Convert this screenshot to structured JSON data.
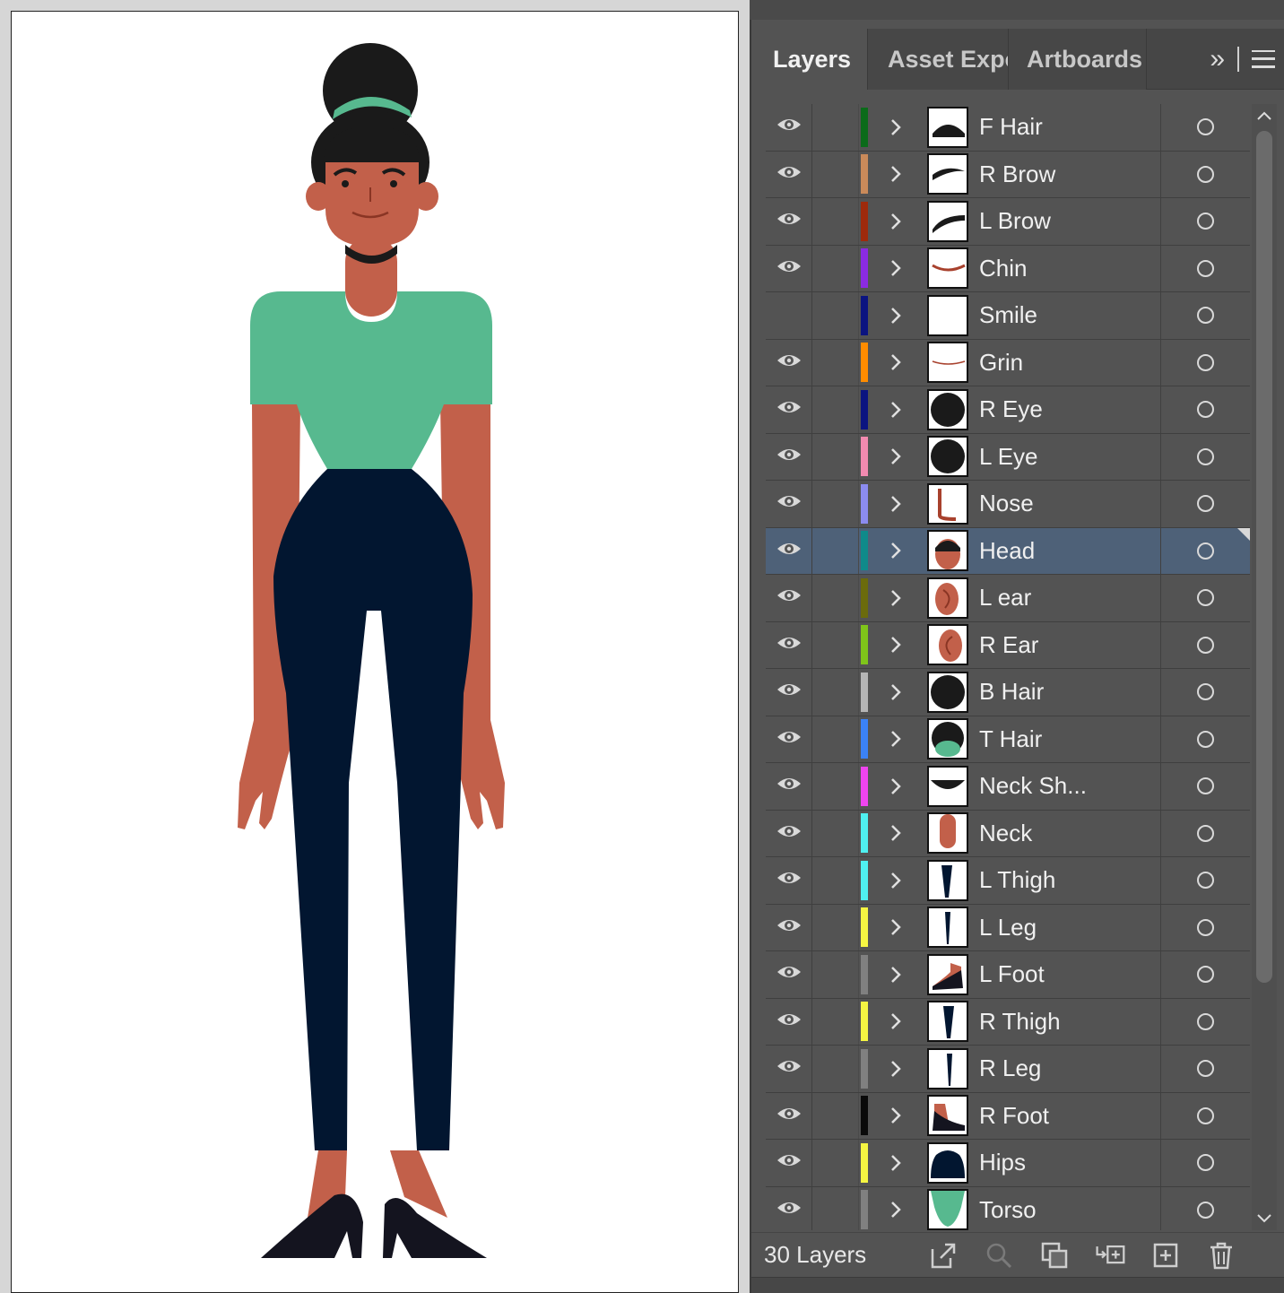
{
  "tabs": {
    "layers": "Layers",
    "asset_export": "Asset Expo",
    "artboards": "Artboards",
    "more": "»"
  },
  "layers": [
    {
      "name": "F Hair",
      "visible": true,
      "color": "#0b6b1a",
      "icon": "f-hair-thumb"
    },
    {
      "name": "R Brow",
      "visible": true,
      "color": "#c98a5a",
      "icon": "r-brow-thumb"
    },
    {
      "name": "L Brow",
      "visible": true,
      "color": "#9e2a0c",
      "icon": "l-brow-thumb"
    },
    {
      "name": "Chin",
      "visible": true,
      "color": "#8a2be2",
      "icon": "chin-thumb"
    },
    {
      "name": "Smile",
      "visible": false,
      "color": "#0b1480",
      "icon": "smile-thumb"
    },
    {
      "name": "Grin",
      "visible": true,
      "color": "#ff8c00",
      "icon": "grin-thumb"
    },
    {
      "name": "R Eye",
      "visible": true,
      "color": "#0b1480",
      "icon": "r-eye-thumb"
    },
    {
      "name": "L Eye",
      "visible": true,
      "color": "#f28ab0",
      "icon": "l-eye-thumb"
    },
    {
      "name": "Nose",
      "visible": true,
      "color": "#8c8cf0",
      "icon": "nose-thumb"
    },
    {
      "name": "Head",
      "visible": true,
      "color": "#0f8a8a",
      "icon": "head-thumb",
      "selected": true
    },
    {
      "name": "L ear",
      "visible": true,
      "color": "#6b6b0c",
      "icon": "l-ear-thumb"
    },
    {
      "name": "R Ear",
      "visible": true,
      "color": "#7fc41a",
      "icon": "r-ear-thumb"
    },
    {
      "name": "B Hair",
      "visible": true,
      "color": "#b5b5b5",
      "icon": "b-hair-thumb"
    },
    {
      "name": "T Hair",
      "visible": true,
      "color": "#3b82f6",
      "icon": "t-hair-thumb"
    },
    {
      "name": "Neck Sh...",
      "visible": true,
      "color": "#ee44ee",
      "icon": "neck-shadow-thumb"
    },
    {
      "name": "Neck",
      "visible": true,
      "color": "#4ff0f0",
      "icon": "neck-thumb"
    },
    {
      "name": "L Thigh",
      "visible": true,
      "color": "#4ff0f0",
      "icon": "l-thigh-thumb"
    },
    {
      "name": "L Leg",
      "visible": true,
      "color": "#f5f542",
      "icon": "l-leg-thumb"
    },
    {
      "name": "L Foot",
      "visible": true,
      "color": "#808080",
      "icon": "l-foot-thumb"
    },
    {
      "name": "R Thigh",
      "visible": true,
      "color": "#f5f542",
      "icon": "r-thigh-thumb"
    },
    {
      "name": "R Leg",
      "visible": true,
      "color": "#808080",
      "icon": "r-leg-thumb"
    },
    {
      "name": "R Foot",
      "visible": true,
      "color": "#0a0a0a",
      "icon": "r-foot-thumb"
    },
    {
      "name": "Hips",
      "visible": true,
      "color": "#f5f542",
      "icon": "hips-thumb"
    },
    {
      "name": "Torso",
      "visible": true,
      "color": "#808080",
      "icon": "torso-thumb"
    }
  ],
  "footer": {
    "layer_count": "30 Layers"
  },
  "colors": {
    "skin": "#c2604a",
    "hair": "#1a1a1a",
    "shirt": "#57b98f",
    "pants": "#021630",
    "shoes": "#14141f",
    "selection": "#4e6178"
  }
}
